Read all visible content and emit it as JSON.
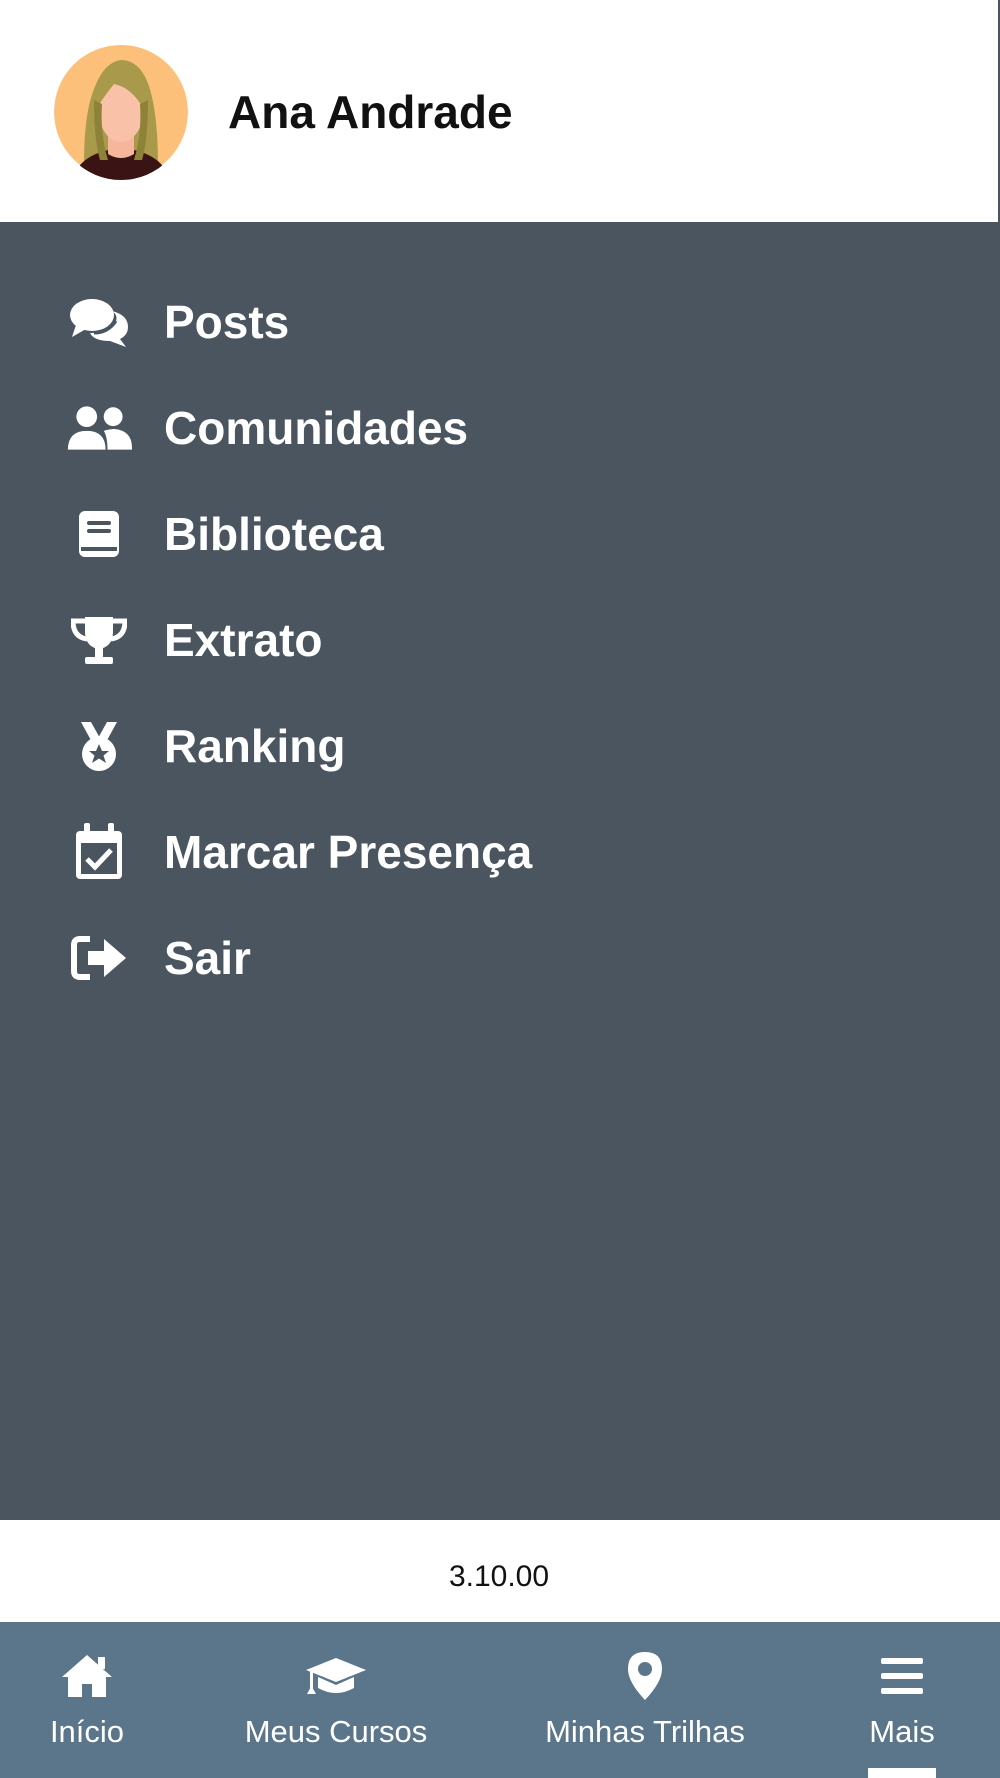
{
  "profile": {
    "name": "Ana Andrade",
    "avatar_icon": "user-avatar-woman"
  },
  "menu": {
    "items": [
      {
        "label": "Posts",
        "icon": "comments-icon"
      },
      {
        "label": "Comunidades",
        "icon": "users-icon"
      },
      {
        "label": "Biblioteca",
        "icon": "book-icon"
      },
      {
        "label": "Extrato",
        "icon": "trophy-icon"
      },
      {
        "label": "Ranking",
        "icon": "medal-icon"
      },
      {
        "label": "Marcar Presença",
        "icon": "calendar-check-icon"
      },
      {
        "label": "Sair",
        "icon": "sign-out-icon"
      }
    ]
  },
  "version": "3.10.00",
  "bottom_nav": {
    "items": [
      {
        "label": "Início",
        "icon": "home-icon"
      },
      {
        "label": "Meus Cursos",
        "icon": "graduation-cap-icon"
      },
      {
        "label": "Minhas Trilhas",
        "icon": "map-marker-icon"
      },
      {
        "label": "Mais",
        "icon": "bars-icon",
        "active": true
      }
    ]
  },
  "colors": {
    "menu_background": "#4a5560",
    "nav_background": "#5b768a",
    "header_background": "#ffffff",
    "text_light": "#ffffff",
    "text_dark": "#111111"
  }
}
